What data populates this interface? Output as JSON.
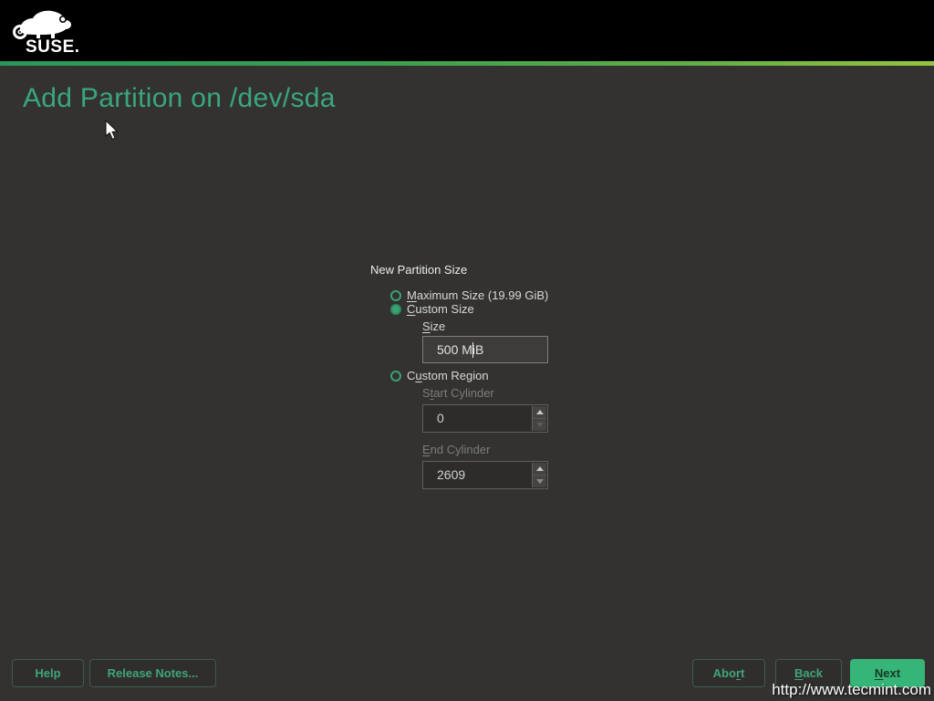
{
  "header": {
    "logo_text": "SUSE."
  },
  "title": "Add Partition on /dev/sda",
  "form": {
    "heading": "New Partition Size",
    "maximum": {
      "pre": "",
      "key": "M",
      "post": "aximum Size (19.99 GiB)",
      "selected": false
    },
    "custom_size": {
      "pre": "",
      "key": "C",
      "post": "ustom Size",
      "selected": true
    },
    "size_label": {
      "pre": "",
      "key": "S",
      "post": "ize"
    },
    "size_value": "500 MiB",
    "custom_region": {
      "pre": "C",
      "key": "u",
      "post": "stom Region",
      "selected": false
    },
    "start_label": {
      "pre": "S",
      "key": "t",
      "post": "art Cylinder"
    },
    "start_value": "0",
    "end_label": {
      "pre": "",
      "key": "E",
      "post": "nd Cylinder"
    },
    "end_value": "2609"
  },
  "buttons": {
    "help": "Help",
    "release_notes": "Release Notes...",
    "abort": {
      "pre": "Abo",
      "key": "r",
      "post": "t"
    },
    "back": {
      "pre": "",
      "key": "B",
      "post": "ack"
    },
    "next": {
      "pre": "",
      "key": "N",
      "post": "ext"
    }
  },
  "watermark": "http://www.tecmint.com",
  "colors": {
    "accent_green": "#3aa77b",
    "next_button_green": "#36b578",
    "header_black": "#000000",
    "page_background": "#333231",
    "gradient_start": "#28985a",
    "gradient_end": "#95c53c"
  }
}
